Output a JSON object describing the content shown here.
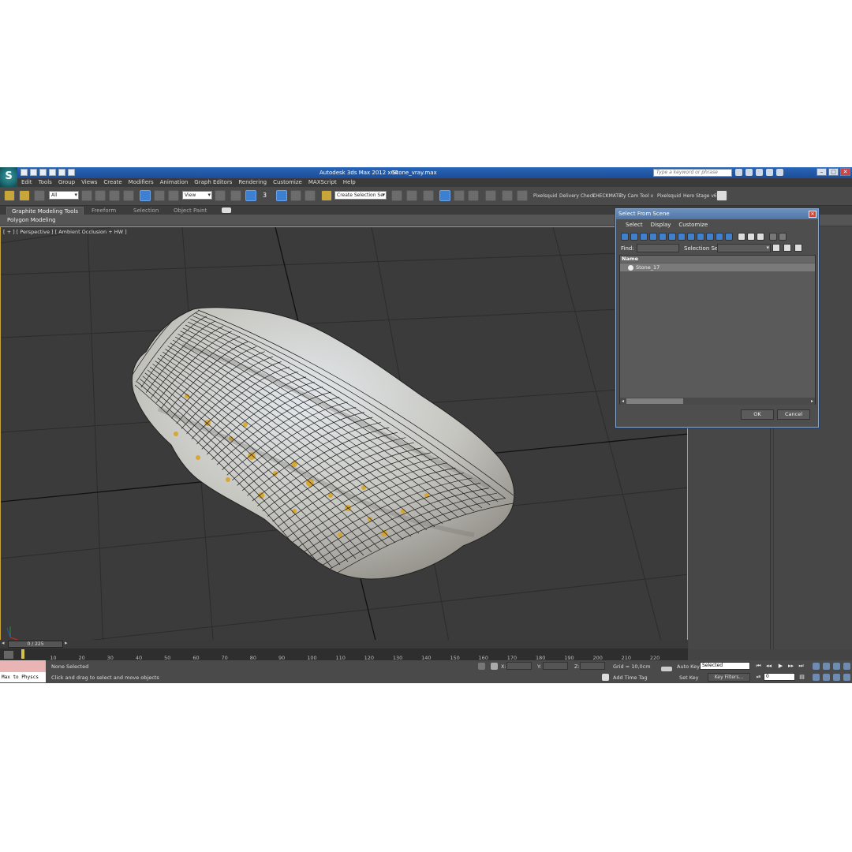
{
  "titlebar": {
    "app_title": "Autodesk 3ds Max  2012 x64",
    "file_title": "Stone_vray.max",
    "search_placeholder": "Type a keyword or phrase"
  },
  "menubar": [
    "Edit",
    "Tools",
    "Group",
    "Views",
    "Create",
    "Modifiers",
    "Animation",
    "Graph Editors",
    "Rendering",
    "Customize",
    "MAXScript",
    "Help"
  ],
  "toolbar": {
    "filter_select": "All",
    "ref_coord_select": "View",
    "snap_label": "3",
    "named_selection": "Create Selection Se",
    "plugins": [
      "Pixelsquid",
      "Delivery Check",
      "CHECKMATE",
      "ity Cam Tool v",
      "Pixelsquid",
      "Hero Stage v6"
    ]
  },
  "ribbon": {
    "tabs": [
      "Graphite Modeling Tools",
      "Freeform",
      "Selection",
      "Object Paint"
    ],
    "panel_label": "Polygon Modeling"
  },
  "viewport": {
    "label": "[ + ] [ Perspective ] [ Ambient Occlusion + HW ]"
  },
  "dialog": {
    "title": "Select From Scene",
    "menu": [
      "Select",
      "Display",
      "Customize"
    ],
    "find_label": "Find:",
    "selection_set_label": "Selection Set:",
    "list_header": "Name",
    "items": [
      "Stone_17"
    ],
    "ok": "OK",
    "cancel": "Cancel"
  },
  "timeline": {
    "frame_indicator": "0 / 225",
    "ticks": [
      "10",
      "20",
      "30",
      "40",
      "50",
      "60",
      "70",
      "80",
      "90",
      "100",
      "110",
      "120",
      "130",
      "140",
      "150",
      "160",
      "170",
      "180",
      "190",
      "200",
      "210",
      "220"
    ]
  },
  "status": {
    "maxscript_listener": "Max to Physcs",
    "selection": "None Selected",
    "prompt": "Click and drag to select and move objects",
    "x_label": "X:",
    "y_label": "Y:",
    "z_label": "Z:",
    "grid": "Grid = 10,0cm",
    "add_time_tag": "Add Time Tag",
    "auto_key": "Auto Key",
    "set_key": "Set Key",
    "selected": "Selected",
    "key_filters": "Key Filters...",
    "current_frame": "0"
  },
  "colors": {
    "title_blue": "#1b4d96",
    "viewport_border": "#c8a23a",
    "stone_base": "#c9c9c4",
    "lichen": "#d9a21c"
  }
}
